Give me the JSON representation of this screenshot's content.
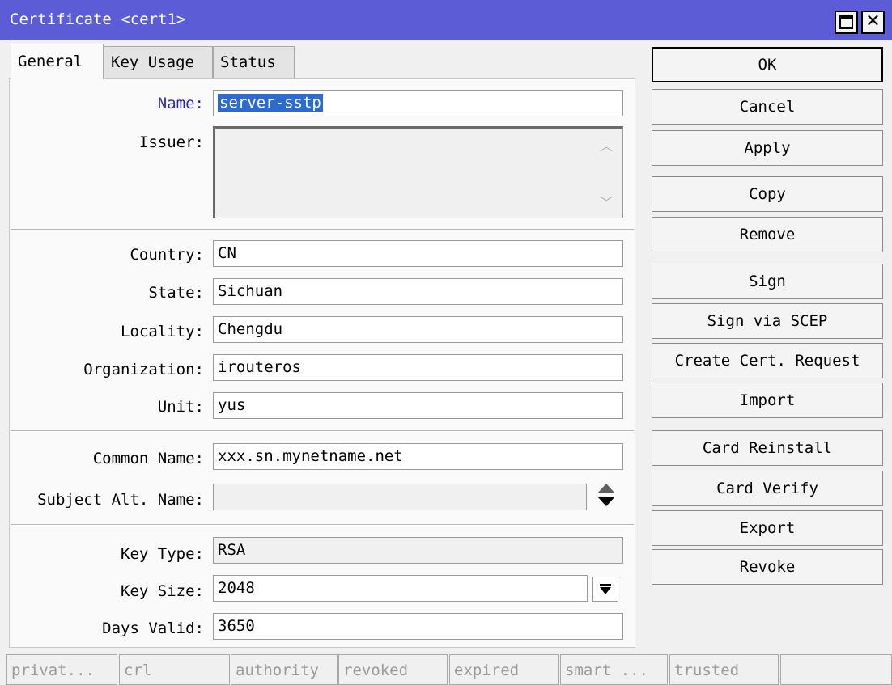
{
  "window": {
    "title": "Certificate <cert1>"
  },
  "tabs": [
    {
      "label": "General",
      "active": true
    },
    {
      "label": "Key Usage",
      "active": false
    },
    {
      "label": "Status",
      "active": false
    }
  ],
  "form": {
    "name": {
      "label": "Name:",
      "value": "server-sstp"
    },
    "issuer": {
      "label": "Issuer:",
      "value": ""
    },
    "country": {
      "label": "Country:",
      "value": "CN"
    },
    "state": {
      "label": "State:",
      "value": "Sichuan"
    },
    "locality": {
      "label": "Locality:",
      "value": "Chengdu"
    },
    "organization": {
      "label": "Organization:",
      "value": "irouteros"
    },
    "unit": {
      "label": "Unit:",
      "value": "yus"
    },
    "common_name": {
      "label": "Common Name:",
      "value": "xxx.sn.mynetname.net"
    },
    "subject_alt_name": {
      "label": "Subject Alt. Name:",
      "value": ""
    },
    "key_type": {
      "label": "Key Type:",
      "value": "RSA"
    },
    "key_size": {
      "label": "Key Size:",
      "value": "2048"
    },
    "days_valid": {
      "label": "Days Valid:",
      "value": "3650"
    }
  },
  "buttons": {
    "ok": "OK",
    "cancel": "Cancel",
    "apply": "Apply",
    "copy": "Copy",
    "remove": "Remove",
    "sign": "Sign",
    "sign_scep": "Sign via SCEP",
    "create_request": "Create Cert. Request",
    "import": "Import",
    "card_reinstall": "Card Reinstall",
    "card_verify": "Card Verify",
    "export": "Export",
    "revoke": "Revoke"
  },
  "status_bar": [
    "privat...",
    "crl",
    "authority",
    "revoked",
    "expired",
    "smart ...",
    "trusted",
    ""
  ],
  "colors": {
    "titlebar": "#5c5cd6",
    "selection": "#2d6bcc",
    "label_focus": "#2a2aa8"
  },
  "icons": {
    "maximize": "maximize-icon",
    "close": "close-icon",
    "scroll_up": "chevron-up-icon",
    "scroll_down": "chevron-down-icon",
    "add_remove": "up-down-arrows-icon",
    "dropdown": "dropdown-arrow-icon"
  }
}
